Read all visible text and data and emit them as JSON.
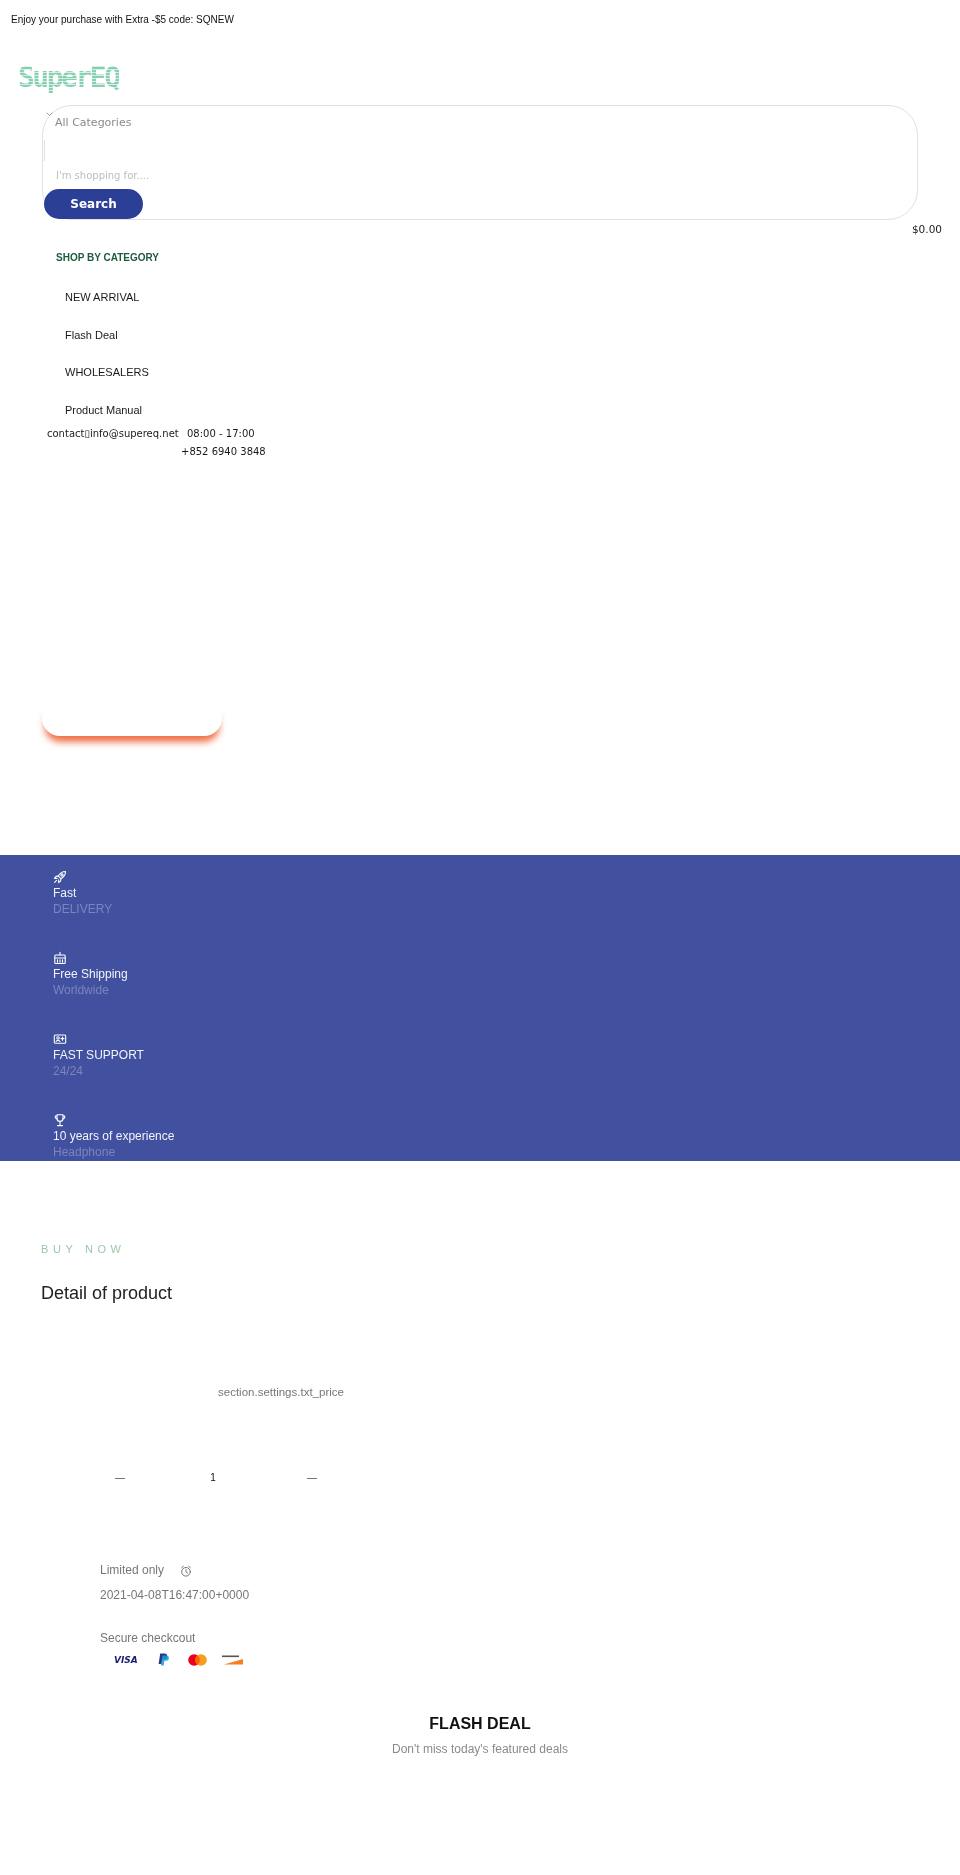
{
  "announcement_bar": {
    "text": "Enjoy your purchase with Extra -$5 code: SQNEW"
  },
  "header": {
    "logo_text": "SuperEQ",
    "search": {
      "category": "All Categories",
      "placeholder": "I'm shopping for....",
      "button": "Search"
    },
    "cart_total": "$0.00"
  },
  "category_menu": {
    "title": "SHOP BY CATEGORY",
    "items": [
      "NEW ARRIVAL",
      "Flash Deal",
      "WHOLESALERS",
      "Product Manual"
    ]
  },
  "contact": {
    "email": "contact▯info@supereq.net",
    "hours": "08:00 - 17:00",
    "phone": "+852 6940 3848"
  },
  "features": [
    {
      "kind": "rocket",
      "title": "Fast",
      "subtitle": "DELIVERY"
    },
    {
      "kind": "calendar",
      "title": "Free Shipping",
      "subtitle": "Worldwide"
    },
    {
      "kind": "id_card",
      "title": "FAST SUPPORT",
      "subtitle": "24/24"
    },
    {
      "kind": "trophy",
      "title": "10 years of experience",
      "subtitle": "Headphone"
    }
  ],
  "product": {
    "eyebrow": "BUY NOW",
    "title": "Detail of product",
    "price": "section.settings.txt_price",
    "quantity": {
      "decrease": "—",
      "value": "1",
      "increase": "—"
    },
    "countdown": {
      "label": "Limited only",
      "deadline": "2021-04-08T16:47:00+0000"
    },
    "checkout": {
      "label": "Secure checkcout",
      "payment_methods": [
        {
          "kind": "visa",
          "label": "VISA"
        },
        {
          "kind": "paypal"
        },
        {
          "kind": "mastercard"
        },
        {
          "kind": "discover"
        }
      ]
    }
  },
  "flash_deal": {
    "title": "FLASH DEAL",
    "subtitle": "Don't miss today's featured deals"
  }
}
